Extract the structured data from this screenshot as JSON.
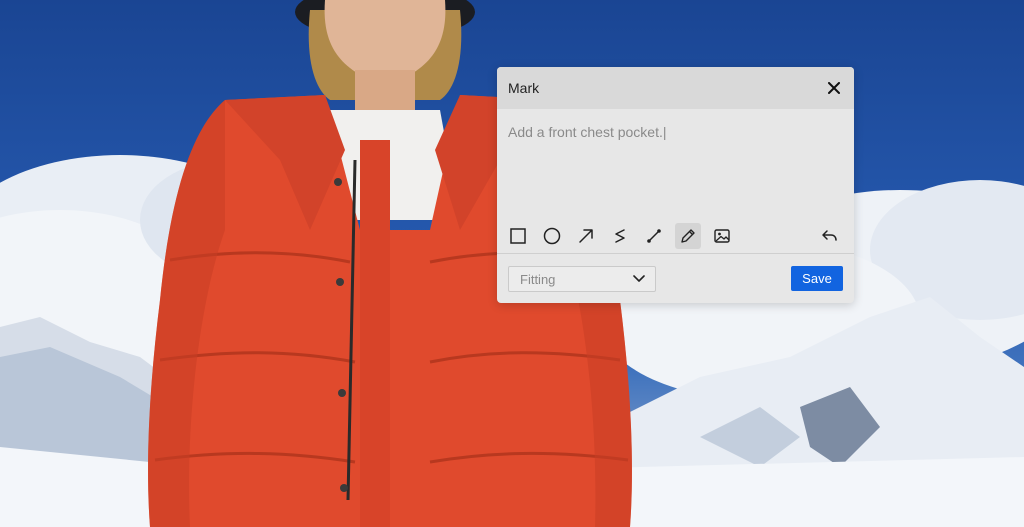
{
  "dialog": {
    "title": "Mark",
    "text_value": "Add a front chest pocket.|",
    "tools": [
      {
        "name": "rectangle-tool",
        "icon": "square-outline-icon"
      },
      {
        "name": "ellipse-tool",
        "icon": "circle-outline-icon"
      },
      {
        "name": "arrow-tool",
        "icon": "arrow-up-right-icon"
      },
      {
        "name": "freehand-tool",
        "icon": "squiggle-icon"
      },
      {
        "name": "line-tool",
        "icon": "line-segment-icon"
      },
      {
        "name": "pencil-tool",
        "icon": "pencil-icon",
        "active": true
      },
      {
        "name": "image-tool",
        "icon": "image-icon"
      }
    ],
    "undo_icon": "undo-icon",
    "select_value": "Fitting",
    "save_label": "Save"
  },
  "colors": {
    "accent": "#1264e0",
    "jacket": "#e04a2d",
    "sky": "#1f4fa0"
  }
}
